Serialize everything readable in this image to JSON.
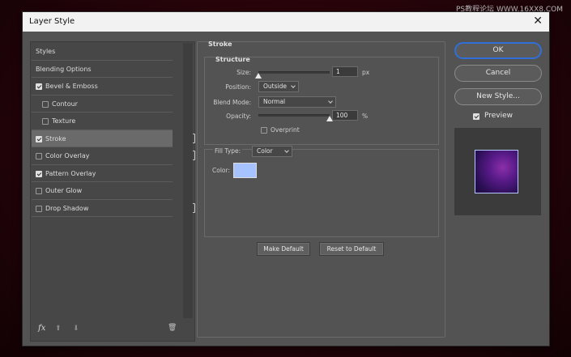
{
  "watermark": "PS教程论坛 WWW.16XX8.COM",
  "dialog": {
    "title": "Layer Style",
    "close_glyph": "✕"
  },
  "styles_list": [
    {
      "label": "Styles",
      "checkbox": false,
      "checked": false,
      "plus": false,
      "selected": false,
      "indent": 0
    },
    {
      "label": "Blending Options",
      "checkbox": false,
      "checked": false,
      "plus": false,
      "selected": false,
      "indent": 0
    },
    {
      "label": "Bevel & Emboss",
      "checkbox": true,
      "checked": true,
      "plus": false,
      "selected": false,
      "indent": 0
    },
    {
      "label": "Contour",
      "checkbox": true,
      "checked": false,
      "plus": false,
      "selected": false,
      "indent": 1
    },
    {
      "label": "Texture",
      "checkbox": true,
      "checked": false,
      "plus": false,
      "selected": false,
      "indent": 1
    },
    {
      "label": "Stroke",
      "checkbox": true,
      "checked": true,
      "plus": true,
      "selected": true,
      "indent": 0
    },
    {
      "label": "Color Overlay",
      "checkbox": true,
      "checked": false,
      "plus": true,
      "selected": false,
      "indent": 0
    },
    {
      "label": "Pattern Overlay",
      "checkbox": true,
      "checked": true,
      "plus": false,
      "selected": false,
      "indent": 0
    },
    {
      "label": "Outer Glow",
      "checkbox": true,
      "checked": false,
      "plus": false,
      "selected": false,
      "indent": 0
    },
    {
      "label": "Drop Shadow",
      "checkbox": true,
      "checked": false,
      "plus": true,
      "selected": false,
      "indent": 0
    }
  ],
  "bottom_tools": {
    "fx": "fx",
    "up": "⬆",
    "down": "⬇",
    "trash": "🗑"
  },
  "stroke": {
    "title": "Stroke",
    "structure_title": "Structure",
    "size_label": "Size:",
    "size_value": "1",
    "size_unit": "px",
    "size_fraction": 0.0,
    "position_label": "Position:",
    "position_value": "Outside",
    "blend_label": "Blend Mode:",
    "blend_value": "Normal",
    "opacity_label": "Opacity:",
    "opacity_value": "100",
    "opacity_unit": "%",
    "opacity_fraction": 1.0,
    "overprint_label": "Overprint",
    "overprint_checked": false,
    "fill_type_label": "Fill Type:",
    "fill_type_value": "Color",
    "color_label": "Color:",
    "color_hex": "#a6c2ff",
    "make_default": "Make Default",
    "reset_default": "Reset to Default"
  },
  "right": {
    "ok": "OK",
    "cancel": "Cancel",
    "new_style": "New Style...",
    "preview_label": "Preview",
    "preview_checked": true
  },
  "colors": {
    "accent": "#2f6fd8",
    "dialog_bg": "#535353",
    "swatch": "#a6c2ff"
  }
}
